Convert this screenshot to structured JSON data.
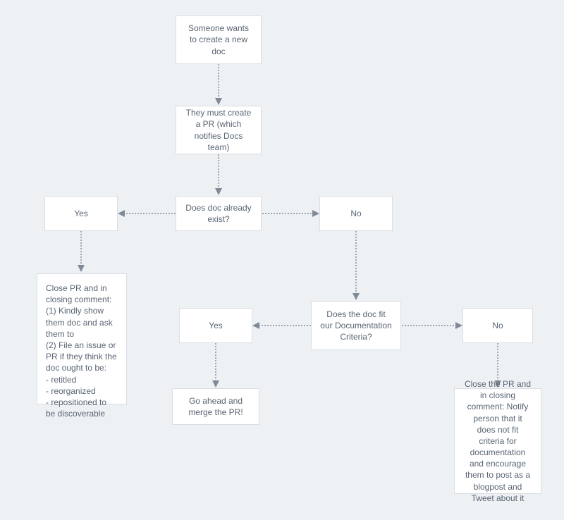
{
  "chart_data": {
    "type": "flowchart",
    "nodes": [
      {
        "id": "n1",
        "text": "Someone wants to create a new doc"
      },
      {
        "id": "n2",
        "text": "They must create a PR (which notifies Docs team)"
      },
      {
        "id": "n3",
        "text": "Does doc already exist?"
      },
      {
        "id": "yes1",
        "text": "Yes"
      },
      {
        "id": "no1",
        "text": "No"
      },
      {
        "id": "close1",
        "text": "Close PR and in closing comment:\n(1) Kindly show them doc and ask them to\n(2) File an issue or PR if they think the doc ought to be:\n- retitled\n- reorganized\n- repositioned to be discoverable"
      },
      {
        "id": "n4",
        "text": "Does the doc fit our Documentation Criteria?"
      },
      {
        "id": "yes2",
        "text": "Yes"
      },
      {
        "id": "no2",
        "text": "No"
      },
      {
        "id": "merge",
        "text": "Go ahead and merge the PR!"
      },
      {
        "id": "close2",
        "text": "Close the PR and in closing comment: Notify person that it does not fit criteria for documentation and encourage them to post as a blogpost and Tweet about it"
      }
    ],
    "edges": [
      {
        "from": "n1",
        "to": "n2"
      },
      {
        "from": "n2",
        "to": "n3"
      },
      {
        "from": "n3",
        "to": "yes1"
      },
      {
        "from": "n3",
        "to": "no1"
      },
      {
        "from": "yes1",
        "to": "close1"
      },
      {
        "from": "no1",
        "to": "n4"
      },
      {
        "from": "n4",
        "to": "yes2"
      },
      {
        "from": "n4",
        "to": "no2"
      },
      {
        "from": "yes2",
        "to": "merge"
      },
      {
        "from": "no2",
        "to": "close2"
      }
    ]
  },
  "nodes": {
    "n1": "Someone wants to create a new doc",
    "n2": "They must create a PR (which notifies Docs team)",
    "n3": "Does doc already exist?",
    "yes1": "Yes",
    "no1": "No",
    "close1": "Close PR and in closing comment:\n(1) Kindly show them doc and ask them to\n(2) File an issue or PR if they think the doc ought to be:\n- retitled\n- reorganized\n- repositioned to be discoverable",
    "n4": "Does the doc fit our Documentation Criteria?",
    "yes2": "Yes",
    "no2": "No",
    "merge": "Go ahead and merge the PR!",
    "close2": "Close the PR and in closing comment: Notify person that it does not fit criteria for documentation and encourage them to post as a blogpost and Tweet about it"
  }
}
